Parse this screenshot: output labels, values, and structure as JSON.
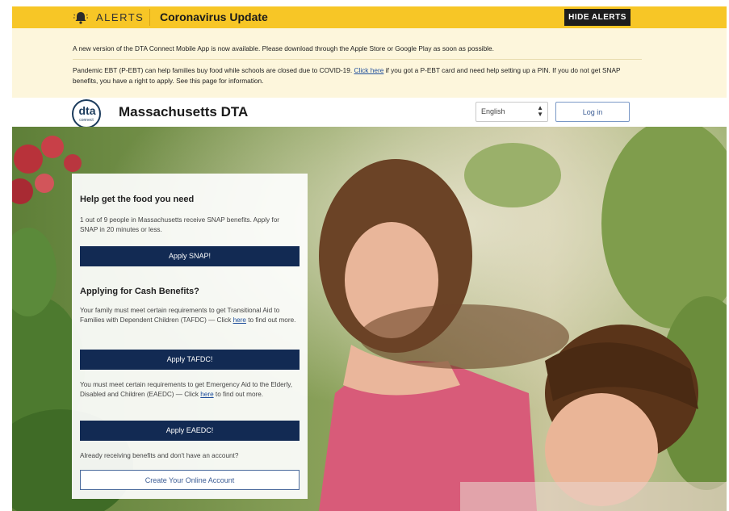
{
  "alert_bar": {
    "label": "ALERTS",
    "title": "Coronavirus Update",
    "hide_button": "HIDE ALERTS"
  },
  "alerts": {
    "message1": "A new version of the DTA Connect Mobile App is now available. Please download through the Apple Store or Google Play as soon as possible.",
    "message2_before": "Pandemic EBT (P-EBT) can help families buy food while schools are closed due to COVID-19. ",
    "message2_link": "Click here",
    "message2_after": " if you got a P-EBT card and need help setting up a PIN. If you do not get SNAP benefits, you have a right to apply. See this page for information."
  },
  "header": {
    "logo_text": "dta",
    "logo_sub": "connect",
    "site_title": "Massachusetts DTA",
    "language": "English",
    "login": "Log in"
  },
  "card": {
    "snap_heading": "Help get the food you need",
    "snap_text": "1 out of 9 people in Massachusetts receive SNAP benefits. Apply for SNAP in 20 minutes or less.",
    "snap_button": "Apply SNAP!",
    "cash_heading": "Applying for Cash Benefits?",
    "tafdc_text_before": "Your family must meet certain requirements to get Transitional Aid to Families with Dependent Children (TAFDC) — Click ",
    "tafdc_link": "here",
    "tafdc_text_after": " to find out more.",
    "tafdc_button": "Apply TAFDC!",
    "eaedc_text_before": "You must meet certain requirements to get Emergency Aid to the Elderly, Disabled and Children (EAEDC) — Click ",
    "eaedc_link": "here",
    "eaedc_text_after": " to find out more.",
    "eaedc_button": "Apply EAEDC!",
    "account_text": "Already receiving benefits and don't have an account?",
    "account_button": "Create Your Online Account"
  },
  "colors": {
    "alert_yellow": "#f7c626",
    "navy_button": "#122a53",
    "link_blue": "#1f4e9b"
  }
}
